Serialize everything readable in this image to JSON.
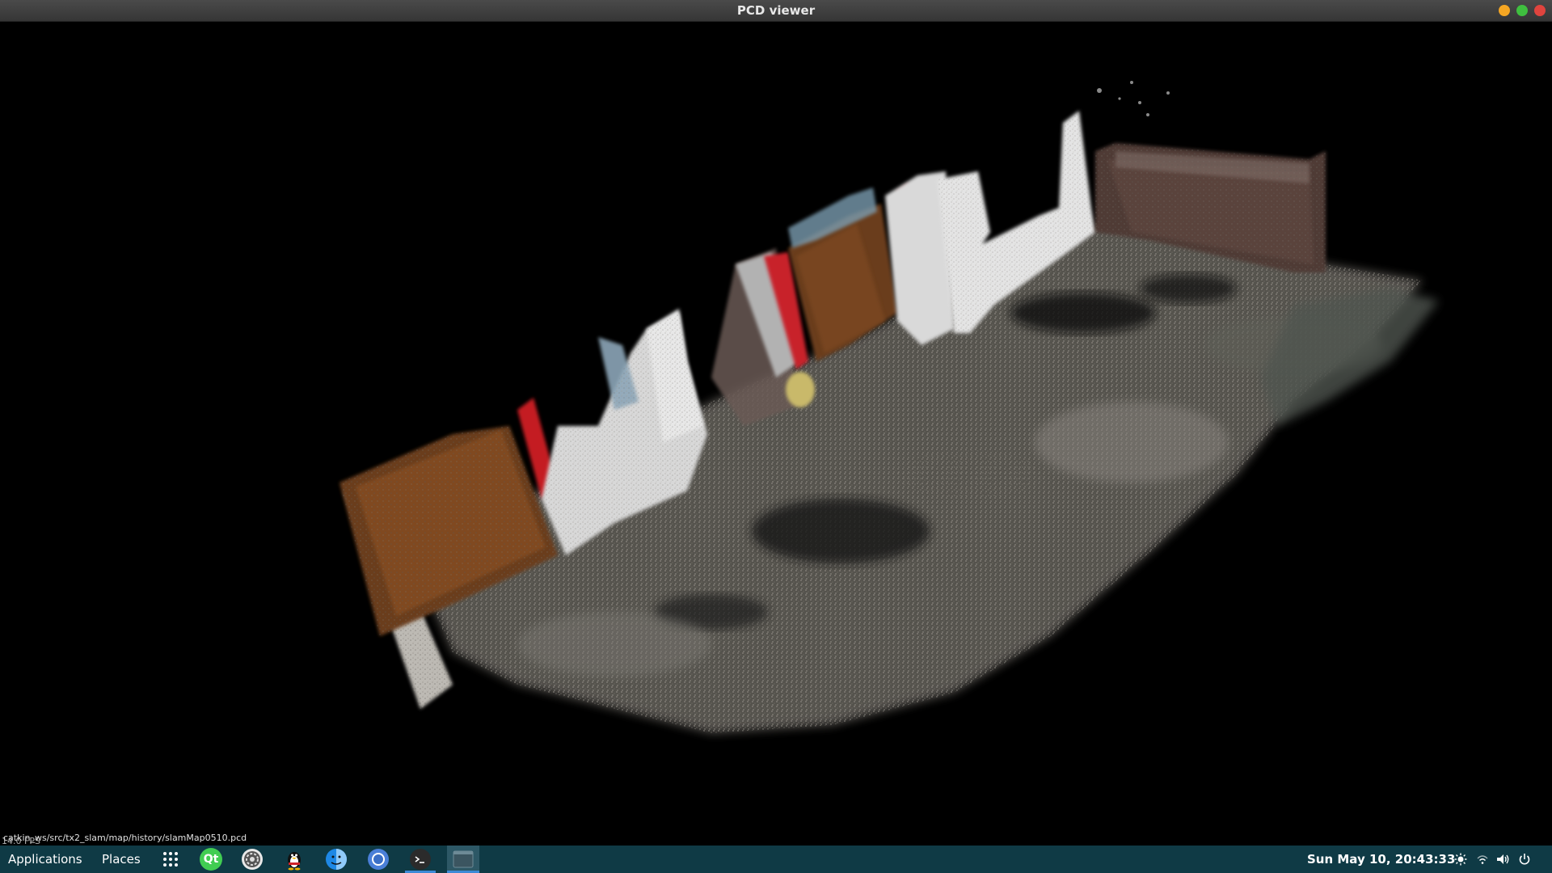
{
  "window": {
    "title": "PCD viewer"
  },
  "viewer": {
    "fps_text": "14.0 FPS",
    "file_path": "catkin_ws/src/tx2_slam/map/history/slamMap0510.pcd"
  },
  "taskbar": {
    "applications_label": "Applications",
    "places_label": "Places",
    "apps": [
      {
        "name": "app-grid-icon"
      },
      {
        "name": "qt-creator-icon",
        "label": "Qt"
      },
      {
        "name": "settings-icon"
      },
      {
        "name": "qq-penguin-icon"
      },
      {
        "name": "finder-icon"
      },
      {
        "name": "chromium-icon"
      },
      {
        "name": "terminal-icon"
      },
      {
        "name": "pcd-viewer-window-icon"
      }
    ],
    "clock": "Sun May 10, 20:43:33",
    "tray": [
      "brightness-icon",
      "network-icon",
      "volume-icon",
      "power-icon"
    ]
  },
  "colors": {
    "title_bar": "#3e3e3e",
    "taskbar": "#0f3a45",
    "viewer_background": "#000000"
  }
}
